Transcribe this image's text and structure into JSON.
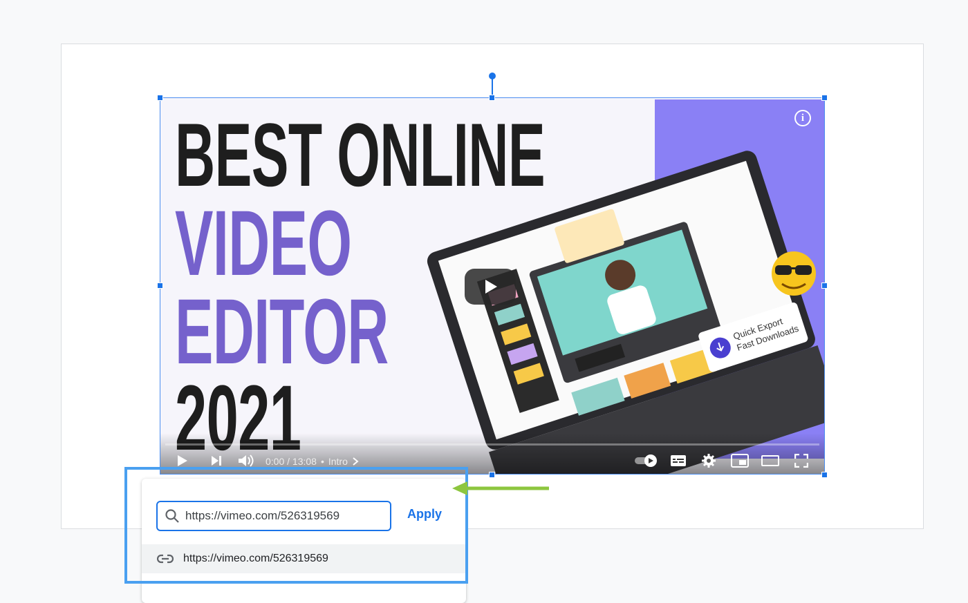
{
  "thumbnail": {
    "line1": "BEST ONLINE",
    "line2": "VIDEO",
    "line3": "EDITOR",
    "line4": "2021",
    "card_line1": "Quick Export",
    "card_line2": "Fast Downloads",
    "purple_color": "#8a80f5",
    "title_accent": "#7561cc"
  },
  "player": {
    "time": "0:00 / 13:08",
    "chapter": "Intro",
    "info_label": "i"
  },
  "popup": {
    "url_value": "https://vimeo.com/526319569",
    "apply_label": "Apply",
    "suggestion_url": "https://vimeo.com/526319569"
  },
  "colors": {
    "selection": "#1a73e8",
    "highlight": "#4aa0f0",
    "arrow": "#8dc63f"
  }
}
